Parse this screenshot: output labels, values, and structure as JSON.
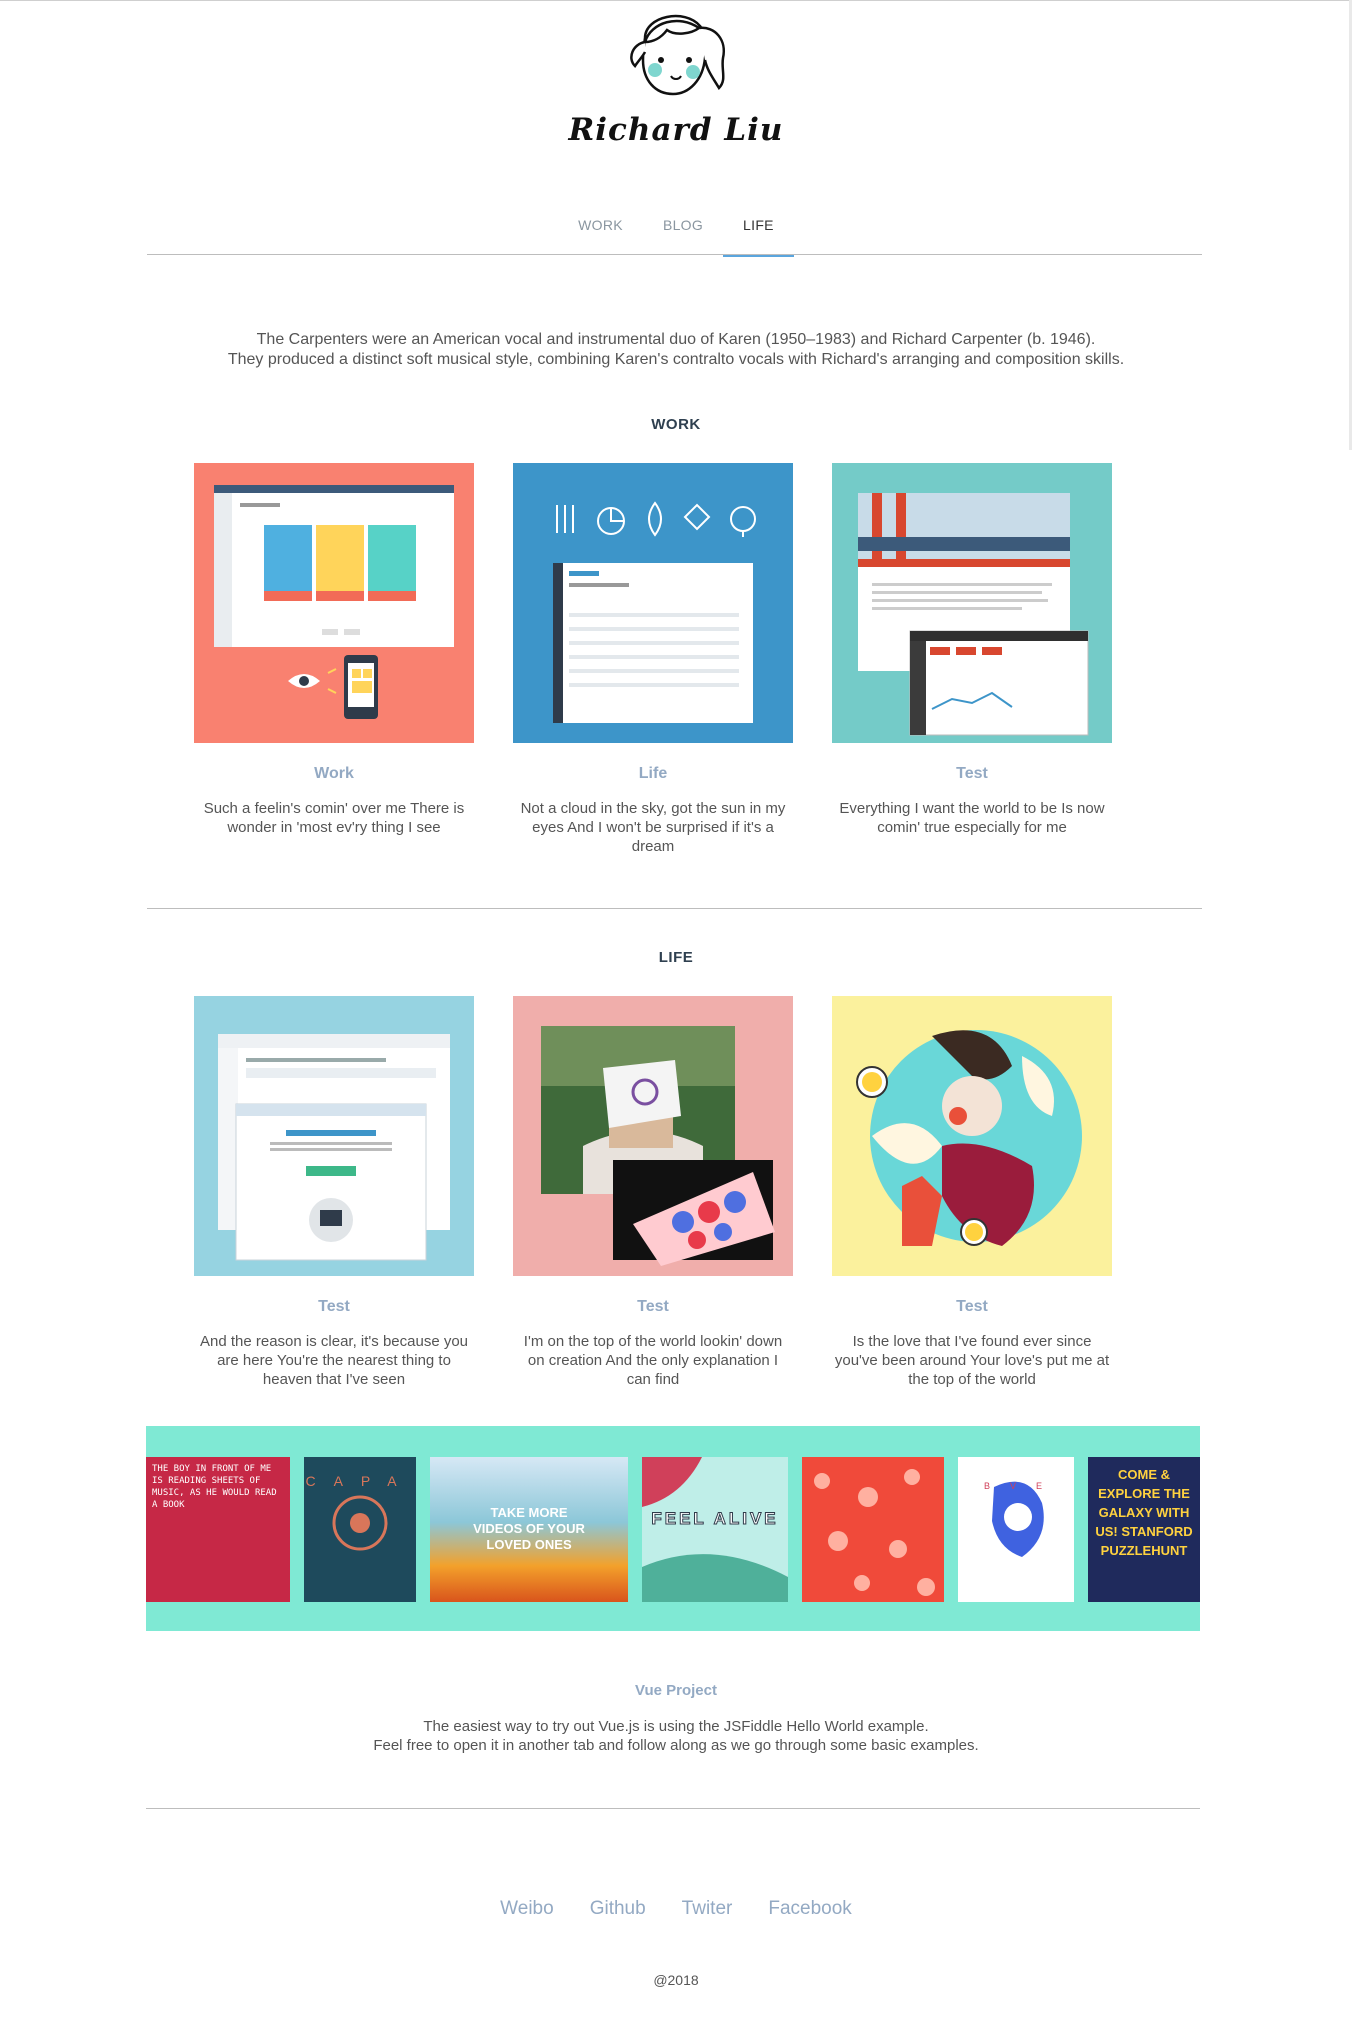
{
  "site": {
    "name": "Richard Liu"
  },
  "nav": {
    "items": [
      {
        "label": "WORK",
        "active": false
      },
      {
        "label": "BLOG",
        "active": false
      },
      {
        "label": "LIFE",
        "active": true
      }
    ]
  },
  "intro": {
    "line1": "The Carpenters were an American vocal and instrumental duo of Karen (1950–1983) and Richard Carpenter (b. 1946).",
    "line2": "They produced a distinct soft musical style, combining Karen's contralto vocals with Richard's arranging and composition skills."
  },
  "work_section": {
    "title": "WORK",
    "cards": [
      {
        "title": "Work",
        "desc": "Such a feelin's comin' over me There is wonder in 'most ev'ry thing I see",
        "bg": "#f98170"
      },
      {
        "title": "Life",
        "desc": "Not a cloud in the sky, got the sun in my eyes And I won't be surprised if it's a dream",
        "bg": "#3d95c9"
      },
      {
        "title": "Test",
        "desc": "Everything I want the world to be Is now comin' true especially for me",
        "bg": "#74cbc8"
      }
    ]
  },
  "life_section": {
    "title": "LIFE",
    "cards": [
      {
        "title": "Test",
        "desc": "And the reason is clear, it's because you are here You're the nearest thing to heaven that I've seen",
        "bg": "#96d3e1"
      },
      {
        "title": "Test",
        "desc": "I'm on the top of the world lookin' down on creation And the only explanation I can find",
        "bg": "#f0aeab"
      },
      {
        "title": "Test",
        "desc": "Is the love that I've found ever since you've been around Your love's put me at the top of the world",
        "bg": "#fbf19d"
      }
    ]
  },
  "gallery": {
    "tiles": [
      {
        "caption": "THE BOY IN FRONT OF ME IS READING SHEETS OF MUSIC, AS HE WOULD READ A BOOK"
      },
      {
        "caption": "CAPA"
      },
      {
        "caption": "TAKE MORE VIDEOS OF YOUR LOVED ONES"
      },
      {
        "caption": "FEEL ALIVE"
      },
      {
        "caption": ""
      },
      {
        "caption": "BVE"
      },
      {
        "caption": "COME & EXPLORE THE GALAXY WITH US! STANFORD PUZZLEHUNT"
      }
    ]
  },
  "vue_project": {
    "title": "Vue Project",
    "line1": "The easiest way to try out Vue.js is using the JSFiddle Hello World example.",
    "line2": "Feel free to open it in another tab and follow along as we go through some basic examples."
  },
  "footer": {
    "links": [
      "Weibo",
      "Github",
      "Twiter",
      "Facebook"
    ],
    "copyright": "@2018"
  }
}
